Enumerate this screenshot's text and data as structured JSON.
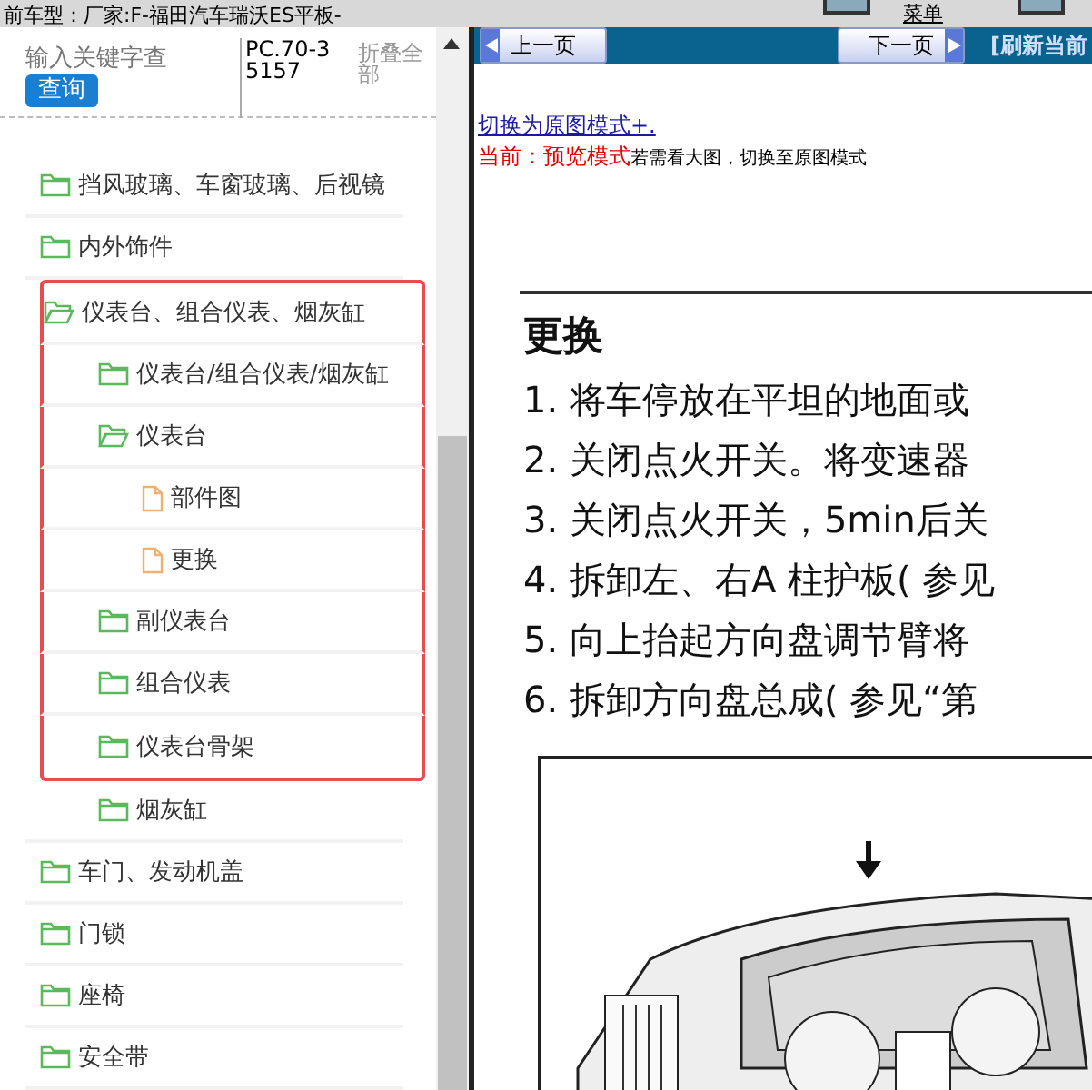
{
  "top_bar": {
    "vehicle": "前车型：厂家:F-福田汽车瑞沃ES平板-",
    "menu_label": "菜单"
  },
  "search": {
    "placeholder": "输入关键字查",
    "button": "查询",
    "code": "PC.70-35157",
    "collapse_all": "折叠全部"
  },
  "tree": [
    {
      "label": "挡风玻璃、车窗玻璃、后视镜",
      "kind": "folder",
      "expanded": false,
      "boxed": false
    },
    {
      "label": "内外饰件",
      "kind": "folder",
      "expanded": false,
      "boxed": false
    },
    {
      "label": "仪表台、组合仪表、烟灰缸",
      "kind": "folder",
      "expanded": true,
      "boxed": true,
      "children": [
        {
          "label": "仪表台/组合仪表/烟灰缸",
          "kind": "folder",
          "expanded": false,
          "boxed": true
        },
        {
          "label": "仪表台",
          "kind": "folder",
          "expanded": true,
          "boxed": true,
          "children": [
            {
              "label": "部件图",
              "kind": "file",
              "boxed": true
            },
            {
              "label": "更换",
              "kind": "file",
              "boxed": true
            }
          ]
        },
        {
          "label": "副仪表台",
          "kind": "folder",
          "expanded": false,
          "boxed": true
        },
        {
          "label": "组合仪表",
          "kind": "folder",
          "expanded": false,
          "boxed": true
        },
        {
          "label": "仪表台骨架",
          "kind": "folder",
          "expanded": false,
          "boxed": true
        },
        {
          "label": "烟灰缸",
          "kind": "folder",
          "expanded": false,
          "boxed": false
        }
      ]
    },
    {
      "label": "车门、发动机盖",
      "kind": "folder",
      "expanded": false,
      "boxed": false
    },
    {
      "label": "门锁",
      "kind": "folder",
      "expanded": false,
      "boxed": false
    },
    {
      "label": "座椅",
      "kind": "folder",
      "expanded": false,
      "boxed": false
    },
    {
      "label": "安全带",
      "kind": "folder",
      "expanded": false,
      "boxed": false
    }
  ],
  "viewer": {
    "prev_button": "上一页",
    "next_button": "下一页",
    "refresh_link": "[刷新当前",
    "switch_link": "切换为原图模式+.",
    "mode_label": "当前：预览模式",
    "mode_hint": "若需看大图，切换至原图模式"
  },
  "document": {
    "heading": "更换",
    "steps": [
      "1. 将车停放在平坦的地面或",
      "2. 关闭点火开关。将变速器",
      "3. 关闭点火开关，5min后关",
      "4. 拆卸左、右A 柱护板( 参见",
      "5. 向上抬起方向盘调节臂将",
      "6. 拆卸方向盘总成( 参见“第"
    ]
  }
}
